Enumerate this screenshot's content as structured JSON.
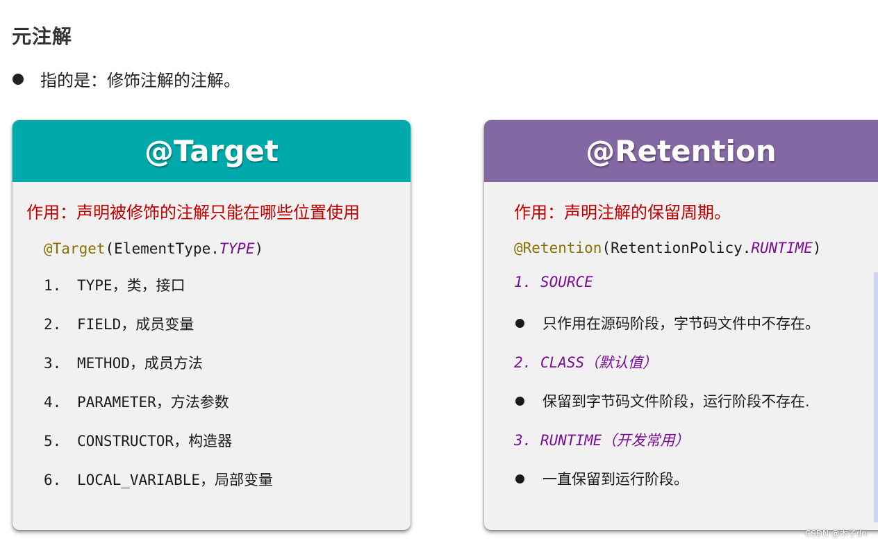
{
  "heading": "元注解",
  "intro": "指的是：修饰注解的注解。",
  "target_card": {
    "title": "@Target",
    "header_color": "#00aaaa",
    "purpose": "作用：声明被修饰的注解只能在哪些位置使用",
    "code": {
      "annotation": "@Target",
      "open": "(ElementType.",
      "constant": "TYPE",
      "close": ")"
    },
    "items": [
      {
        "num": "1.",
        "text": "TYPE，类，接口"
      },
      {
        "num": "2.",
        "text": "FIELD，成员变量"
      },
      {
        "num": "3.",
        "text": "METHOD，成员方法"
      },
      {
        "num": "4.",
        "text": "PARAMETER，方法参数"
      },
      {
        "num": "5.",
        "text": "CONSTRUCTOR，构造器"
      },
      {
        "num": "6.",
        "text": "LOCAL_VARIABLE，局部变量"
      }
    ]
  },
  "retention_card": {
    "title": "@Retention",
    "header_color": "#8468a4",
    "purpose": "作用：声明注解的保留周期。",
    "code": {
      "annotation": "@Retention",
      "open": "(RetentionPolicy.",
      "constant": "RUNTIME",
      "close": ")"
    },
    "policies": [
      {
        "label": "1. SOURCE",
        "desc": "只作用在源码阶段，字节码文件中不存在。"
      },
      {
        "label": "2. CLASS（默认值）",
        "desc": "保留到字节码文件阶段，运行阶段不存在."
      },
      {
        "label": "3. RUNTIME（开发常用）",
        "desc": "一直保留到运行阶段。"
      }
    ]
  },
  "watermark": "CSDN @木子dn"
}
